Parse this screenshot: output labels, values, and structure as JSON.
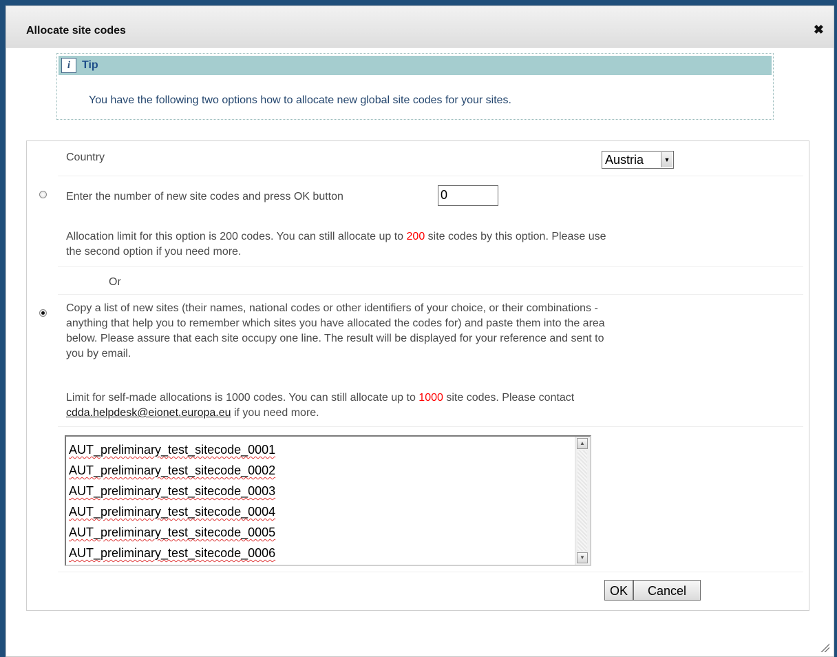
{
  "dialog": {
    "title": "Allocate site codes",
    "close_glyph": "✖"
  },
  "tip": {
    "icon": "info-icon",
    "icon_glyph": "i",
    "title": "Tip",
    "text": "You have the following two options how to allocate new global site codes for your sites."
  },
  "form": {
    "country_label": "Country",
    "country_value": "Austria",
    "option1": {
      "selected": false,
      "label": "Enter the number of new site codes and press OK button",
      "input_value": "0",
      "limit_prefix": "Allocation limit for this option is 200 codes. You can still allocate up to",
      "limit_value": "200",
      "limit_suffix": "site codes by this option. Please use",
      "limit_line2": "the second option if you need more."
    },
    "or_label": "Or",
    "option2": {
      "selected": true,
      "description_lines": [
        "Copy a list of new sites (their names, national codes or other identifiers of your choice, or their combinations -",
        "anything that help you to remember which sites you have allocated the codes for) and paste them into the area",
        "below. Please assure that each site occupy one line. The result will be displayed for your reference and sent to",
        "you by email."
      ],
      "limit_prefix": "Limit for self-made allocations is 1000 codes. You can still allocate up to",
      "limit_value": "1000",
      "limit_suffix": "site codes. Please contact",
      "helpdesk_email": "cdda.helpdesk@eionet.europa.eu",
      "limit_line2_suffix": "if you need more.",
      "sites": [
        "AUT_preliminary_test_sitecode_0001",
        "AUT_preliminary_test_sitecode_0002",
        "AUT_preliminary_test_sitecode_0003",
        "AUT_preliminary_test_sitecode_0004",
        "AUT_preliminary_test_sitecode_0005",
        "AUT_preliminary_test_sitecode_0006"
      ]
    },
    "ok_label": "OK",
    "cancel_label": "Cancel"
  },
  "colors": {
    "tip_header": "#a5cdcf",
    "limit_highlight": "#ff0000",
    "page_background": "#1f4e7a"
  }
}
